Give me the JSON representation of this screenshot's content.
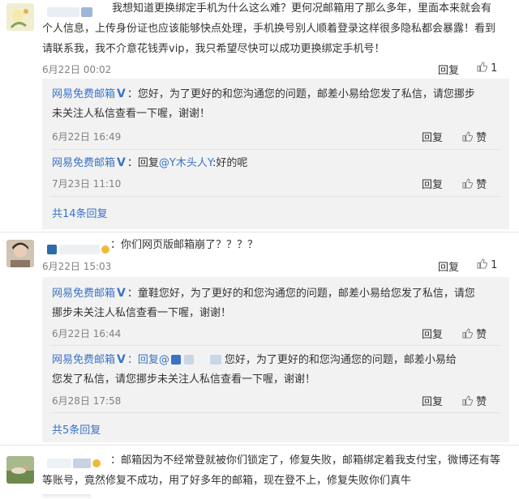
{
  "comments": [
    {
      "text_line1": "我想知道更换绑定手机为什么这么难？更何况邮箱用了那么多年，里面本来就会有",
      "text_line2": "个人信息，上传身份证也应该能够快点处理，手机换号别人顺着登录这样很多隐私都会暴露！看到",
      "text_line3": "请联系我，我不介意花钱弄vip，我只希望尽快可以成功更换绑定手机号！",
      "time": "6月22日 00:02",
      "reply_label": "回复",
      "like_count": "1",
      "replies": [
        {
          "author": "网易免费邮箱",
          "line1": "：您好，为了更好的和您沟通您的问题，邮差小易给您发了私信，请您挪步",
          "line2": "未关注人私信查看一下喔，谢谢！",
          "time": "6月22日 16:49",
          "reply_label": "回复",
          "like_label": "赞"
        },
        {
          "author": "网易免费邮箱",
          "line1_pre": "：回复",
          "mention": "@Y木头人Y",
          "line1_post": ":好的呢",
          "time": "7月23日 11:10",
          "reply_label": "回复",
          "like_label": "赞"
        }
      ],
      "more_replies": "共14条回复"
    },
    {
      "text": "：你们网页版邮箱崩了？？？？",
      "time": "6月22日 15:03",
      "reply_label": "回复",
      "like_count": "1",
      "replies": [
        {
          "author": "网易免费邮箱",
          "line1": "：童鞋您好，为了更好的和您沟通您的问题，邮差小易给您发了私信，请您",
          "line2": "挪步未关注人私信查看一下喔，谢谢！",
          "time": "6月22日 16:44",
          "reply_label": "回复",
          "like_label": "赞"
        },
        {
          "author": "网易免费邮箱",
          "line1_pre": "：回复@",
          "line1_post": "您好，为了更好的和您沟通您的问题，邮差小易给",
          "line2": "您发了私信，请您挪步未关注人私信查看一下喔，谢谢！",
          "time": "6月28日 17:58",
          "reply_label": "回复",
          "like_label": "赞"
        }
      ],
      "more_replies": "共5条回复"
    },
    {
      "text_line1": "：邮箱因为不经常登就被你们锁定了，修复失败，邮箱绑定着我支付宝，微博还有等",
      "text_line2": "等账号，竟然修复不成功，用了好多年的邮箱，现在登不上，修复失败你们真牛"
    }
  ],
  "colors": {
    "link": "#3a73c5",
    "reply_bg": "#f2f2f2"
  }
}
